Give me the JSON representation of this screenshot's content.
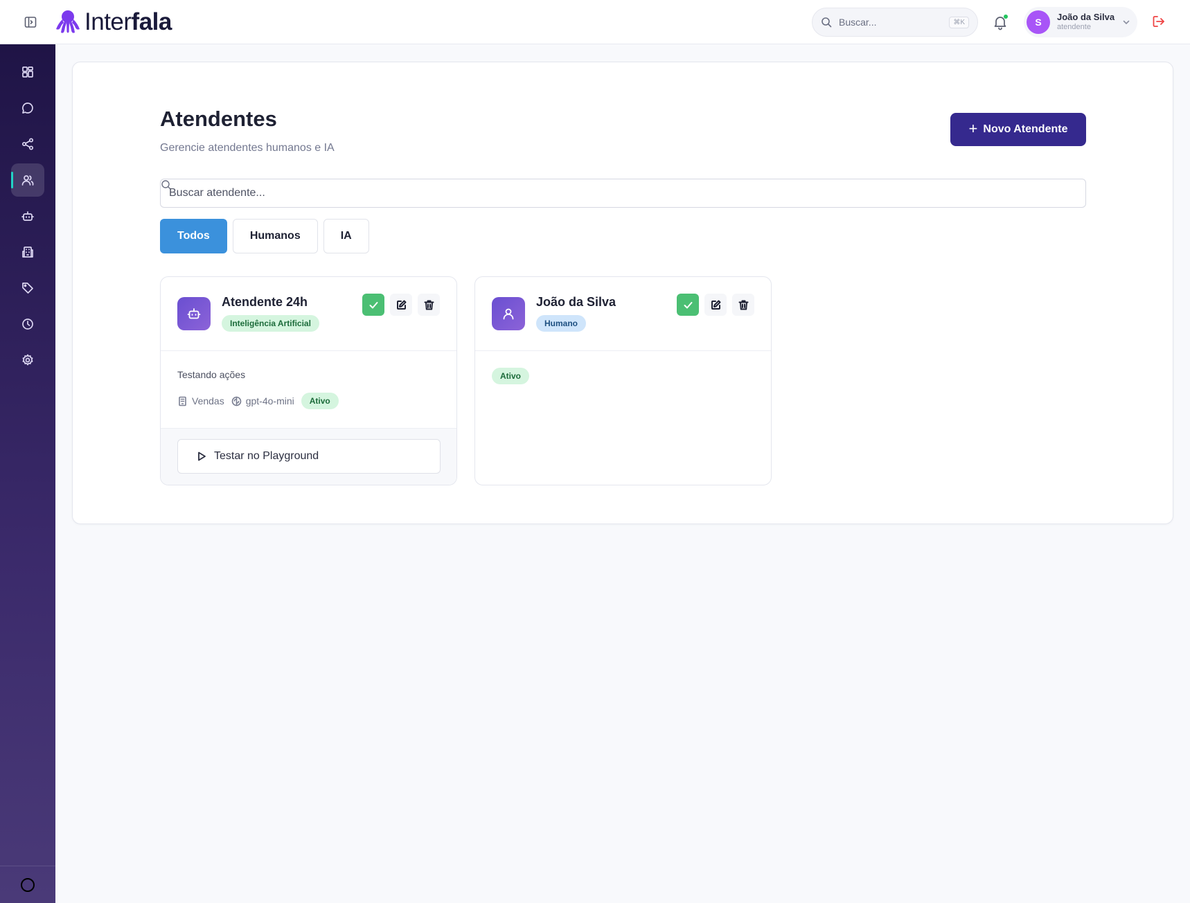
{
  "app": {
    "brand_prefix": "Inter",
    "brand_suffix": "fala",
    "brand_color": "#7c3aed"
  },
  "topbar": {
    "search_placeholder": "Buscar...",
    "search_shortcut": "⌘K",
    "user_initial": "S",
    "user_name": "João da Silva",
    "user_role": "atendente",
    "notification_dot_color": "#22c55e"
  },
  "sidebar": {
    "items": [
      {
        "icon": "dashboard-icon",
        "active": false
      },
      {
        "icon": "chat-icon",
        "active": false
      },
      {
        "icon": "share-icon",
        "active": false
      },
      {
        "icon": "users-icon",
        "active": true
      },
      {
        "icon": "bot-icon",
        "active": false
      },
      {
        "icon": "building-icon",
        "active": false
      },
      {
        "icon": "tag-icon",
        "active": false
      },
      {
        "icon": "clock-icon",
        "active": false
      },
      {
        "icon": "gear-icon",
        "active": false
      }
    ]
  },
  "page": {
    "title": "Atendentes",
    "subtitle": "Gerencie atendentes humanos e IA",
    "new_button_label": "Novo Atendente",
    "search_placeholder": "Buscar atendente...",
    "filters": [
      {
        "label": "Todos",
        "active": true
      },
      {
        "label": "Humanos",
        "active": false
      },
      {
        "label": "IA",
        "active": false
      }
    ]
  },
  "agents": [
    {
      "name": "Atendente 24h",
      "type": "Inteligência Artificial",
      "description": "Testando ações",
      "department": "Vendas",
      "model": "gpt-4o-mini",
      "status": "Ativo",
      "playground_label": "Testar no Playground"
    },
    {
      "name": "João da Silva",
      "type": "Humano",
      "status": "Ativo"
    }
  ]
}
